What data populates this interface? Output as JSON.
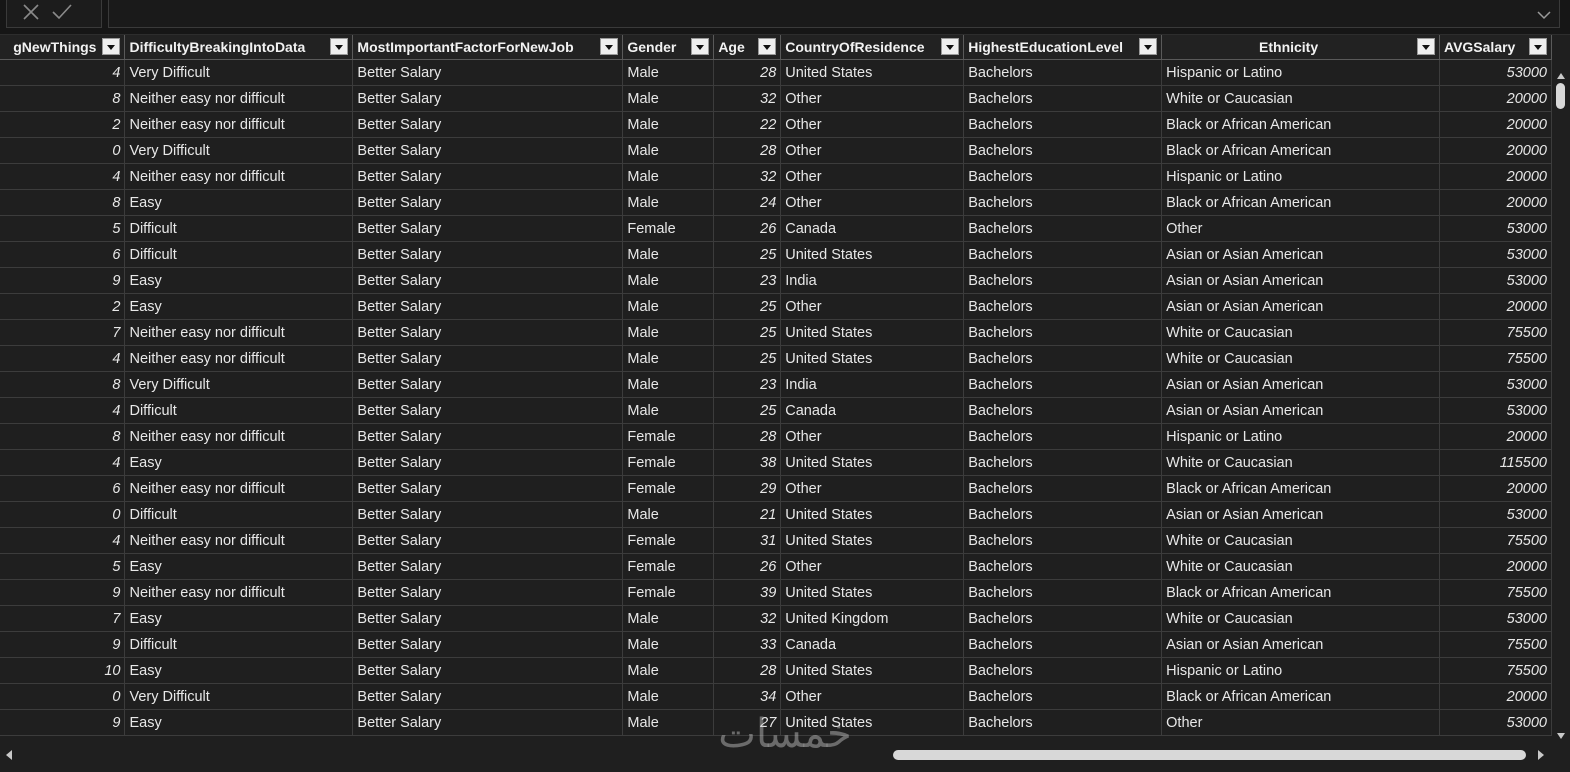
{
  "columns": [
    {
      "label": "gNewThings",
      "align": "right"
    },
    {
      "label": "DifficultyBreakingIntoData",
      "align": "left"
    },
    {
      "label": "MostImportantFactorForNewJob",
      "align": "left"
    },
    {
      "label": "Gender",
      "align": "left"
    },
    {
      "label": "Age",
      "align": "left"
    },
    {
      "label": "CountryOfResidence",
      "align": "left"
    },
    {
      "label": "HighestEducationLevel",
      "align": "left"
    },
    {
      "label": "Ethnicity",
      "align": "center"
    },
    {
      "label": "AVGSalary",
      "align": "left"
    }
  ],
  "rows": [
    [
      "4",
      "Very Difficult",
      "Better Salary",
      "Male",
      "28",
      "United States",
      "Bachelors",
      "Hispanic or Latino",
      "53000"
    ],
    [
      "8",
      "Neither easy nor difficult",
      "Better Salary",
      "Male",
      "32",
      "Other",
      "Bachelors",
      "White or Caucasian",
      "20000"
    ],
    [
      "2",
      "Neither easy nor difficult",
      "Better Salary",
      "Male",
      "22",
      "Other",
      "Bachelors",
      "Black or African American",
      "20000"
    ],
    [
      "0",
      "Very Difficult",
      "Better Salary",
      "Male",
      "28",
      "Other",
      "Bachelors",
      "Black or African American",
      "20000"
    ],
    [
      "4",
      "Neither easy nor difficult",
      "Better Salary",
      "Male",
      "32",
      "Other",
      "Bachelors",
      "Hispanic or Latino",
      "20000"
    ],
    [
      "8",
      "Easy",
      "Better Salary",
      "Male",
      "24",
      "Other",
      "Bachelors",
      "Black or African American",
      "20000"
    ],
    [
      "5",
      "Difficult",
      "Better Salary",
      "Female",
      "26",
      "Canada",
      "Bachelors",
      "Other",
      "53000"
    ],
    [
      "6",
      "Difficult",
      "Better Salary",
      "Male",
      "25",
      "United States",
      "Bachelors",
      "Asian or Asian American",
      "53000"
    ],
    [
      "9",
      "Easy",
      "Better Salary",
      "Male",
      "23",
      "India",
      "Bachelors",
      "Asian or Asian American",
      "53000"
    ],
    [
      "2",
      "Easy",
      "Better Salary",
      "Male",
      "25",
      "Other",
      "Bachelors",
      "Asian or Asian American",
      "20000"
    ],
    [
      "7",
      "Neither easy nor difficult",
      "Better Salary",
      "Male",
      "25",
      "United States",
      "Bachelors",
      "White or Caucasian",
      "75500"
    ],
    [
      "4",
      "Neither easy nor difficult",
      "Better Salary",
      "Male",
      "25",
      "United States",
      "Bachelors",
      "White or Caucasian",
      "75500"
    ],
    [
      "8",
      "Very Difficult",
      "Better Salary",
      "Male",
      "23",
      "India",
      "Bachelors",
      "Asian or Asian American",
      "53000"
    ],
    [
      "4",
      "Difficult",
      "Better Salary",
      "Male",
      "25",
      "Canada",
      "Bachelors",
      "Asian or Asian American",
      "53000"
    ],
    [
      "8",
      "Neither easy nor difficult",
      "Better Salary",
      "Female",
      "28",
      "Other",
      "Bachelors",
      "Hispanic or Latino",
      "20000"
    ],
    [
      "4",
      "Easy",
      "Better Salary",
      "Female",
      "38",
      "United States",
      "Bachelors",
      "White or Caucasian",
      "115500"
    ],
    [
      "6",
      "Neither easy nor difficult",
      "Better Salary",
      "Female",
      "29",
      "Other",
      "Bachelors",
      "Black or African American",
      "20000"
    ],
    [
      "0",
      "Difficult",
      "Better Salary",
      "Male",
      "21",
      "United States",
      "Bachelors",
      "Asian or Asian American",
      "53000"
    ],
    [
      "4",
      "Neither easy nor difficult",
      "Better Salary",
      "Female",
      "31",
      "United States",
      "Bachelors",
      "White or Caucasian",
      "75500"
    ],
    [
      "5",
      "Easy",
      "Better Salary",
      "Female",
      "26",
      "Other",
      "Bachelors",
      "White or Caucasian",
      "20000"
    ],
    [
      "9",
      "Neither easy nor difficult",
      "Better Salary",
      "Female",
      "39",
      "United States",
      "Bachelors",
      "Black or African American",
      "75500"
    ],
    [
      "7",
      "Easy",
      "Better Salary",
      "Male",
      "32",
      "United Kingdom",
      "Bachelors",
      "White or Caucasian",
      "53000"
    ],
    [
      "9",
      "Difficult",
      "Better Salary",
      "Male",
      "33",
      "Canada",
      "Bachelors",
      "Asian or Asian American",
      "75500"
    ],
    [
      "10",
      "Easy",
      "Better Salary",
      "Male",
      "28",
      "United States",
      "Bachelors",
      "Hispanic or Latino",
      "75500"
    ],
    [
      "0",
      "Very Difficult",
      "Better Salary",
      "Male",
      "34",
      "Other",
      "Bachelors",
      "Black or African American",
      "20000"
    ],
    [
      "9",
      "Easy",
      "Better Salary",
      "Male",
      "27",
      "United States",
      "Bachelors",
      "Other",
      "53000"
    ]
  ],
  "numeric_columns": [
    0,
    4,
    8
  ],
  "icons": {
    "cancel": "close-icon",
    "commit": "check-icon",
    "expand": "chevron-down-icon",
    "filter": "filter-dropdown-icon"
  },
  "watermark": "خمسات"
}
